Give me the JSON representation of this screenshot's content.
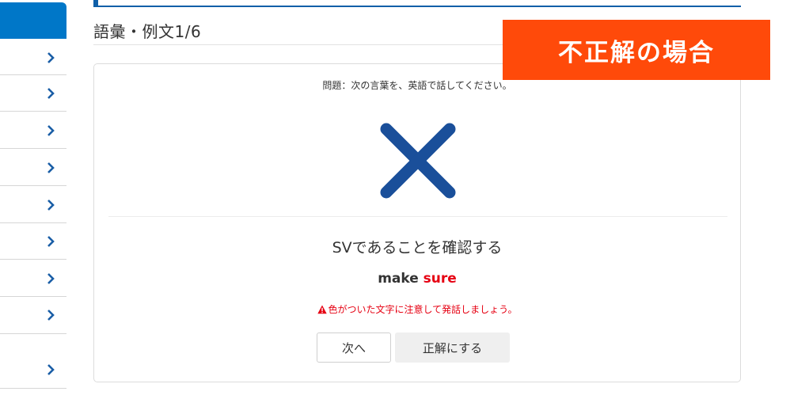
{
  "banner": {
    "text": "不正解の場合"
  },
  "section": {
    "title": "語彙・例文1/6"
  },
  "card": {
    "question": "問題：次の言葉を、英語で話してください。",
    "result_icon": "cross-mark-icon",
    "meaning": "SVであることを確認する",
    "phrase_plain": "make ",
    "phrase_highlight": "sure",
    "warning": "色がついた文字に注意して発話しましょう。",
    "next_label": "次へ",
    "mark_correct_label": "正解にする"
  },
  "colors": {
    "accent_blue": "#0077c8",
    "banner_orange": "#ff4a0a",
    "cross_blue": "#1a4f9a",
    "highlight_red": "#e60012"
  },
  "sidebar": {
    "item_icon": "chevron-right-icon",
    "items": [
      {},
      {},
      {},
      {},
      {},
      {},
      {},
      {},
      {}
    ]
  }
}
